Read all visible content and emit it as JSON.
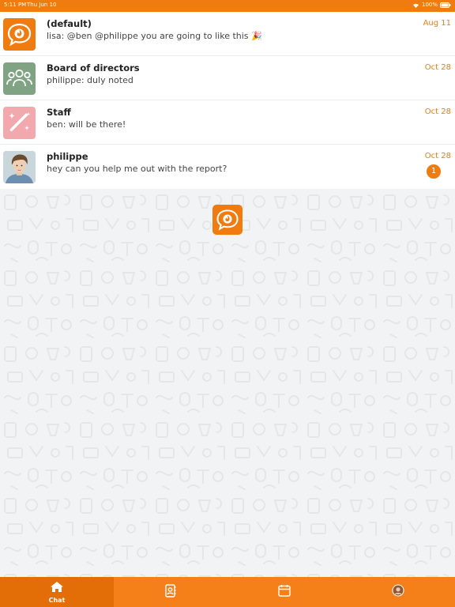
{
  "status_bar": {
    "time": "5:11 PM",
    "date": "Thu Jun 10",
    "battery": "100%"
  },
  "chats": [
    {
      "name": "(default)",
      "preview": "lisa: @ben @philippe you are going to like this 🎉",
      "date": "Aug 11",
      "avatar_icon": "chat-bubble-logo-icon",
      "avatar_color": "#f07c10"
    },
    {
      "name": "Board of directors",
      "preview": "philippe: duly noted",
      "date": "Oct 28",
      "avatar_icon": "group-people-icon",
      "avatar_color": "#7fa383"
    },
    {
      "name": "Staff",
      "preview": "ben: will be there!",
      "date": "Oct 28",
      "avatar_icon": "magic-wand-icon",
      "avatar_color": "#f2a9ad"
    },
    {
      "name": "philippe",
      "preview": "hey can you help me out with the report?",
      "date": "Oct 28",
      "unread": "1",
      "avatar_icon": "user-photo"
    }
  ],
  "tabs": [
    {
      "label": "Chat",
      "icon": "home-icon",
      "active": true
    },
    {
      "label": "",
      "icon": "contacts-icon",
      "active": false
    },
    {
      "label": "",
      "icon": "calendar-icon",
      "active": false
    },
    {
      "label": "",
      "icon": "profile-avatar",
      "active": false
    }
  ],
  "colors": {
    "accent": "#f07c10",
    "tab_active": "#e36e08",
    "background": "#f2f3f4"
  }
}
